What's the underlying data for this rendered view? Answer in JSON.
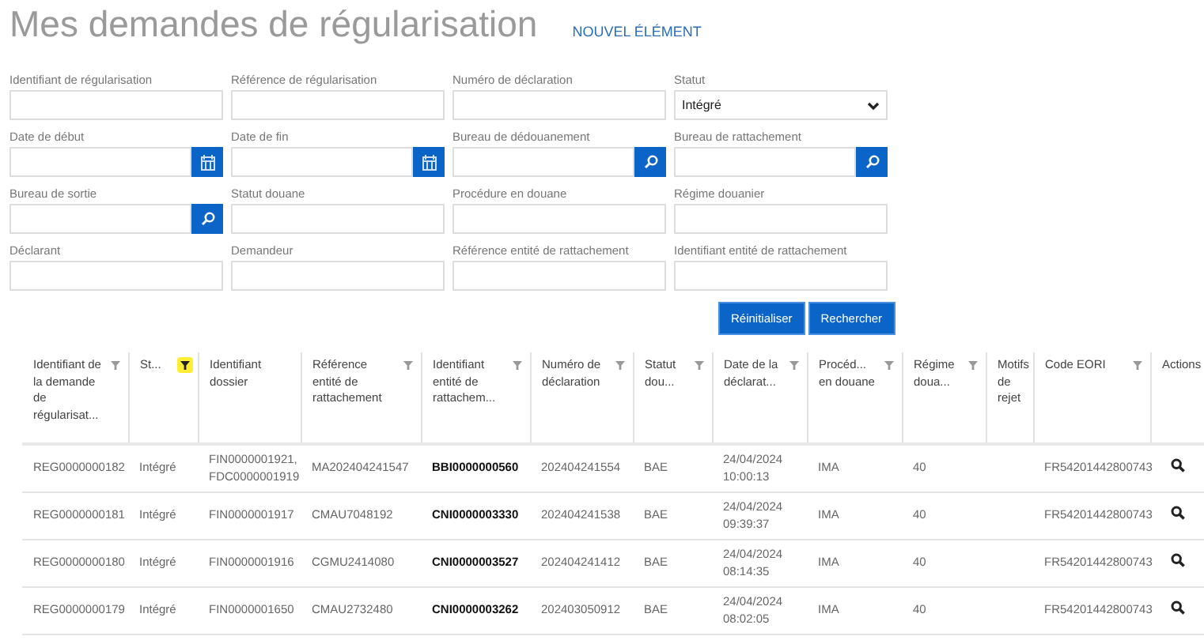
{
  "title": "Mes demandes de régularisation",
  "new_item": "NOUVEL ÉLÉMENT",
  "fields": [
    {
      "label": "Identifiant de régularisation",
      "kind": "text"
    },
    {
      "label": "Référence de régularisation",
      "kind": "text"
    },
    {
      "label": "Numéro de déclaration",
      "kind": "text"
    },
    {
      "label": "Statut",
      "kind": "select",
      "value": "Intégré"
    },
    {
      "label": "Date de début",
      "kind": "date"
    },
    {
      "label": "Date de fin",
      "kind": "date"
    },
    {
      "label": "Bureau de dédouanement",
      "kind": "lookup"
    },
    {
      "label": "Bureau de rattachement",
      "kind": "lookup"
    },
    {
      "label": "Bureau de sortie",
      "kind": "lookup"
    },
    {
      "label": "Statut douane",
      "kind": "text"
    },
    {
      "label": "Procédure en douane",
      "kind": "text"
    },
    {
      "label": "Régime douanier",
      "kind": "text"
    },
    {
      "label": "Déclarant",
      "kind": "text"
    },
    {
      "label": "Demandeur",
      "kind": "text"
    },
    {
      "label": "Référence entité de rattachement",
      "kind": "text"
    },
    {
      "label": "Identifiant entité de rattachement",
      "kind": "text"
    }
  ],
  "buttons": [
    "Réinitialiser",
    "Rechercher"
  ],
  "table": {
    "columns": [
      {
        "label": "Identifiant de la demande de régularisat...",
        "filterable": true,
        "filtered": false,
        "bold": false
      },
      {
        "label": "St...",
        "filterable": true,
        "filtered": true,
        "bold": false
      },
      {
        "label": "Identifiant dossier",
        "filterable": false,
        "bold": false
      },
      {
        "label": "Référence entité de rattachement",
        "filterable": true,
        "filtered": false,
        "bold": false
      },
      {
        "label": "Identifiant entité de rattachem...",
        "filterable": true,
        "filtered": false,
        "bold": true
      },
      {
        "label": "Numéro de déclaration",
        "filterable": true,
        "filtered": false,
        "bold": false
      },
      {
        "label": "Statut dou...",
        "filterable": true,
        "filtered": false,
        "bold": false
      },
      {
        "label": "Date de la déclarat...",
        "filterable": true,
        "filtered": false,
        "bold": false
      },
      {
        "label": "Procéd... en douane",
        "filterable": true,
        "filtered": false,
        "bold": false
      },
      {
        "label": "Régime doua...",
        "filterable": true,
        "filtered": false,
        "bold": false
      },
      {
        "label": "Motifs de rejet",
        "filterable": false
      },
      {
        "label": "Code EORI",
        "filterable": true,
        "filtered": false,
        "bold": false
      },
      {
        "label": "Actions",
        "filterable": false
      }
    ],
    "rows": [
      {
        "cells": [
          "REG0000000182",
          "Intégré",
          "FIN0000001921, FDC0000001919",
          "MA202404241547",
          "BBI0000000560",
          "202404241554",
          "BAE",
          "24/04/2024 10:00:13",
          "IMA",
          "40",
          "",
          "FR54201442800743"
        ]
      },
      {
        "cells": [
          "REG0000000181",
          "Intégré",
          "FIN0000001917",
          "CMAU7048192",
          "CNI0000003330",
          "202404241538",
          "BAE",
          "24/04/2024 09:39:37",
          "IMA",
          "40",
          "",
          "FR54201442800743"
        ]
      },
      {
        "cells": [
          "REG0000000180",
          "Intégré",
          "FIN0000001916",
          "CGMU2414080",
          "CNI0000003527",
          "202404241412",
          "BAE",
          "24/04/2024 08:14:35",
          "IMA",
          "40",
          "",
          "FR54201442800743"
        ]
      },
      {
        "cells": [
          "REG0000000179",
          "Intégré",
          "FIN0000001650",
          "CMAU2732480",
          "CNI0000003262",
          "202403050912",
          "BAE",
          "24/04/2024 08:02:05",
          "IMA",
          "40",
          "",
          "FR54201442800743"
        ]
      }
    ]
  }
}
